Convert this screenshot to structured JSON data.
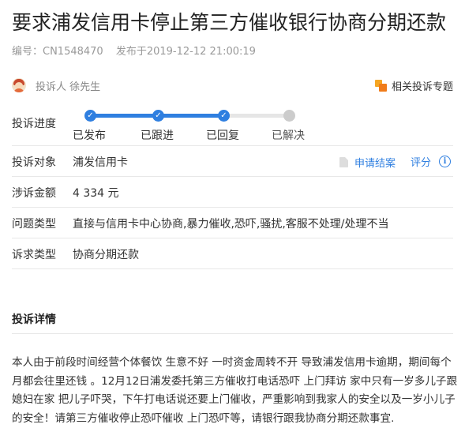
{
  "title": "要求浦发信用卡停止第三方催收银行协商分期还款",
  "meta": {
    "id_text": "编号：CN1548470",
    "published": "发布于2019-12-12 21:00:19"
  },
  "complainant": "投诉人 徐先生",
  "related_topic": "相关投诉专题",
  "progress": {
    "label": "投诉进度",
    "completed_steps": 3,
    "steps": [
      "已发布",
      "已跟进",
      "已回复",
      "已解决"
    ]
  },
  "target": {
    "label": "投诉对象",
    "value": "浦发信用卡",
    "apply": "申请结案",
    "rate": "评分"
  },
  "amount": {
    "label": "涉诉金额",
    "value": "4 334 元"
  },
  "issue": {
    "label": "问题类型",
    "value": "直接与信用卡中心协商,暴力催收,恐吓,骚扰,客服不处理/处理不当"
  },
  "demand": {
    "label": "诉求类型",
    "value": "协商分期还款"
  },
  "details": {
    "title": "投诉详情",
    "text": "本人由于前段时间经营个体餐饮 生意不好 一时资金周转不开 导致浦发信用卡逾期，期间每个月都会往里还钱 。12月12日浦发委托第三方催收打电话恐吓 上门拜访 家中只有一岁多儿子跟媳妇在家 把儿子吓哭，下午打电话说还要上门催收，严重影响到我家人的安全以及一岁小儿子的安全！请第三方催收停止恐吓催收 上门恐吓等，请银行跟我协商分期还款事宜."
  },
  "colors": {
    "accent": "#2f7fe0",
    "inactive": "#cccccc"
  }
}
